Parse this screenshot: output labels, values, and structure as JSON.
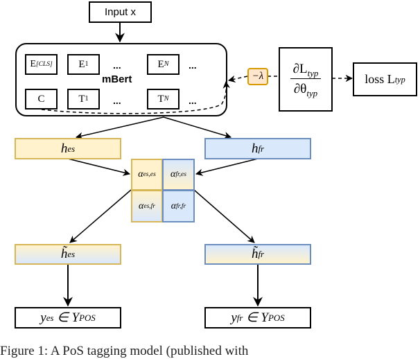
{
  "diagram": {
    "input": {
      "label": "Input x"
    },
    "encoder": {
      "label": "mBert",
      "top_row": [
        {
          "base": "E",
          "sub": "[CLS]"
        },
        {
          "base": "E",
          "sub": "1"
        },
        {
          "ellipsis": "..."
        },
        {
          "base": "E",
          "sub": "N"
        },
        {
          "ellipsis": "..."
        }
      ],
      "bottom_row": [
        {
          "base": "C",
          "sub": ""
        },
        {
          "base": "T",
          "sub": "1"
        },
        {
          "ellipsis": "..."
        },
        {
          "base": "T",
          "sub": "N"
        },
        {
          "ellipsis": "..."
        }
      ]
    },
    "gradient_reversal": {
      "label": "−λ"
    },
    "derivative": {
      "numerator": "∂L",
      "numerator_sub": "typ",
      "denominator": "∂θ",
      "denominator_sub": "typ"
    },
    "loss": {
      "label": "loss L",
      "sub": "typ"
    },
    "hidden": {
      "es": {
        "base": "h",
        "sub": "es"
      },
      "fr": {
        "base": "h",
        "sub": "fr"
      }
    },
    "attention": {
      "cells": [
        {
          "base": "α",
          "sub": "es,es"
        },
        {
          "base": "α",
          "sub": "fr,es"
        },
        {
          "base": "α",
          "sub": "es,fr"
        },
        {
          "base": "α",
          "sub": "fr,fr"
        }
      ]
    },
    "attended": {
      "es": {
        "base": "h̃",
        "sub": "es"
      },
      "fr": {
        "base": "h̃",
        "sub": "fr"
      }
    },
    "outputs": {
      "es": {
        "base": "y",
        "sup": "es",
        "rel": " ∈ Y",
        "sub": "POS"
      },
      "fr": {
        "base": "y",
        "sup": "fr",
        "rel": " ∈ Y",
        "sub": "POS"
      }
    },
    "colors": {
      "spanish_fill": "#fff2cc",
      "spanish_border": "#d6b656",
      "french_fill": "#dae8fc",
      "french_border": "#6c8ebf",
      "lambda_fill": "#ffe6cc",
      "lambda_border": "#d79b00"
    }
  },
  "caption": "Figure 1: A PoS tagging model (published with"
}
